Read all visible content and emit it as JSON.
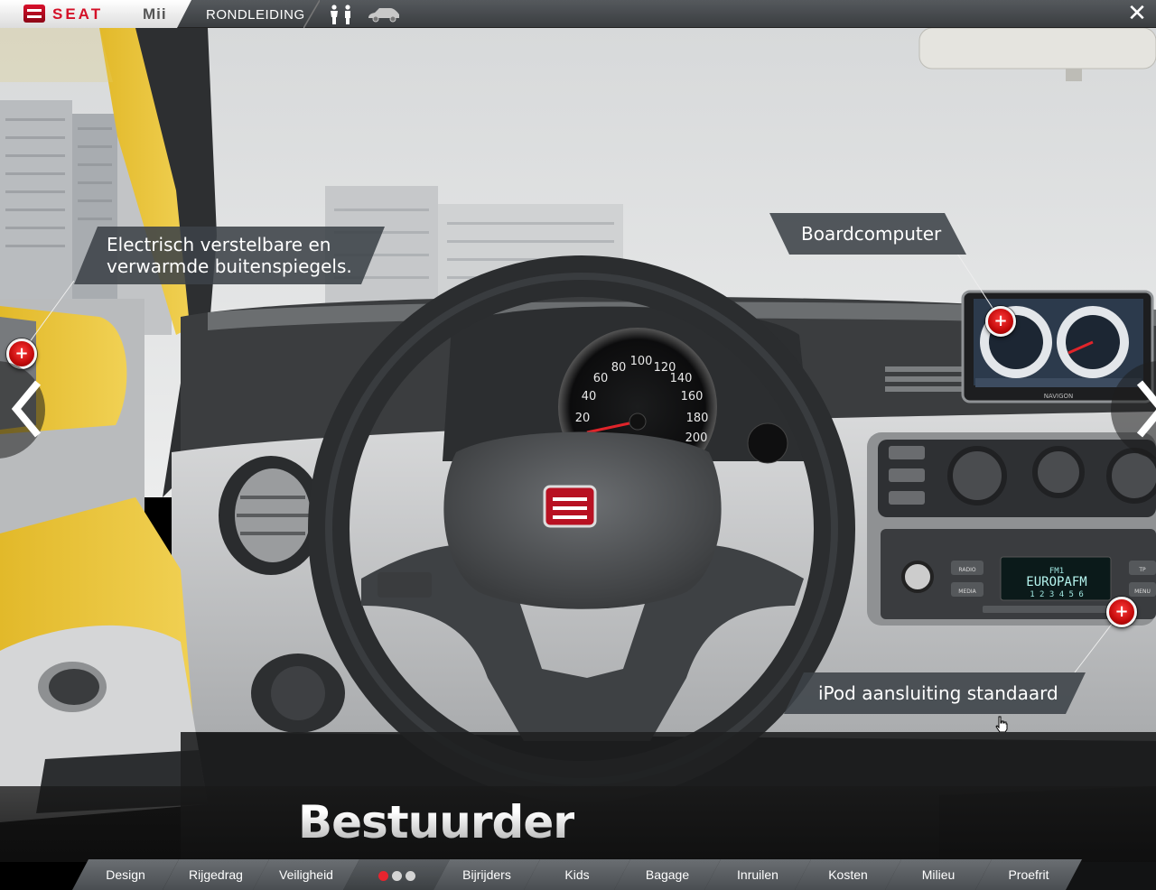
{
  "topbar": {
    "brand": "SEAT",
    "model": "Mii",
    "tour_label": "RONDLEIDING",
    "close_symbol": "✕"
  },
  "icons": {
    "people": "people-icon",
    "car": "car-icon",
    "close": "close-icon",
    "prev": "chevron-left-icon",
    "next": "chevron-right-icon",
    "hotspot": "plus-icon"
  },
  "callouts": {
    "mirror_line1": "Electrisch verstelbare en",
    "mirror_line2": "verwarmde buitenspiegels.",
    "board": "Boardcomputer",
    "ipod": "iPod aansluiting standaard"
  },
  "hotspot_symbol": "+",
  "section_title": "Bestuurder",
  "dashboard": {
    "speedo_labels": [
      "20",
      "40",
      "60",
      "80",
      "100",
      "120",
      "140",
      "160",
      "180",
      "200"
    ],
    "radio_station": "EUROPAFM",
    "radio_band": "FM1",
    "radio_presets": "1 2 3 4 5 6",
    "radio_btn_radio": "RADIO",
    "radio_btn_media": "MEDIA",
    "radio_btn_tp": "TP",
    "radio_btn_menu": "MENU",
    "nav_brand": "NAVIGON"
  },
  "nav": {
    "items": [
      "Design",
      "Rijgedrag",
      "Veiligheid",
      "",
      "Bijrijders",
      "Kids",
      "Bagage",
      "Inruilen",
      "Kosten",
      "Milieu",
      "Proefrit"
    ]
  },
  "colors": {
    "accent": "#d41027",
    "hotspot": "#d9141e",
    "dot_active": "#e8242e",
    "dot_inactive": "#d4d4d4"
  }
}
